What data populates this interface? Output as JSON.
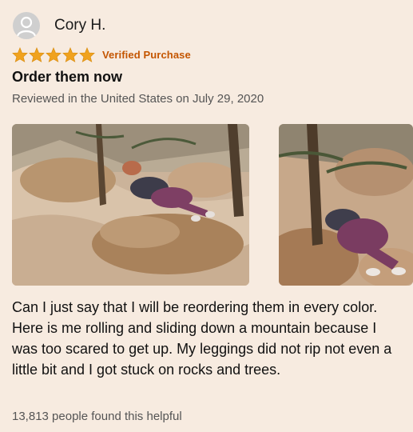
{
  "review": {
    "author": "Cory H.",
    "rating": 5,
    "rating_max": 5,
    "verified_label": "Verified Purchase",
    "title": "Order them now",
    "meta": "Reviewed in the United States on July 29, 2020",
    "body": "Can I just say that I will be reordering them in every color. Here is me rolling and sliding down a mountain because I was too scared to get up. My leggings did not rip not even a little bit and I got stuck on rocks and trees.",
    "helpful": "13,813 people found this helpful",
    "photos": [
      "review-photo-1",
      "review-photo-2"
    ]
  },
  "icons": {
    "avatar": "user-silhouette-icon",
    "star": "star-icon"
  },
  "colors": {
    "background": "#f7ebe0",
    "star": "#f0a21e",
    "verified": "#c45500",
    "meta_text": "#555555"
  }
}
